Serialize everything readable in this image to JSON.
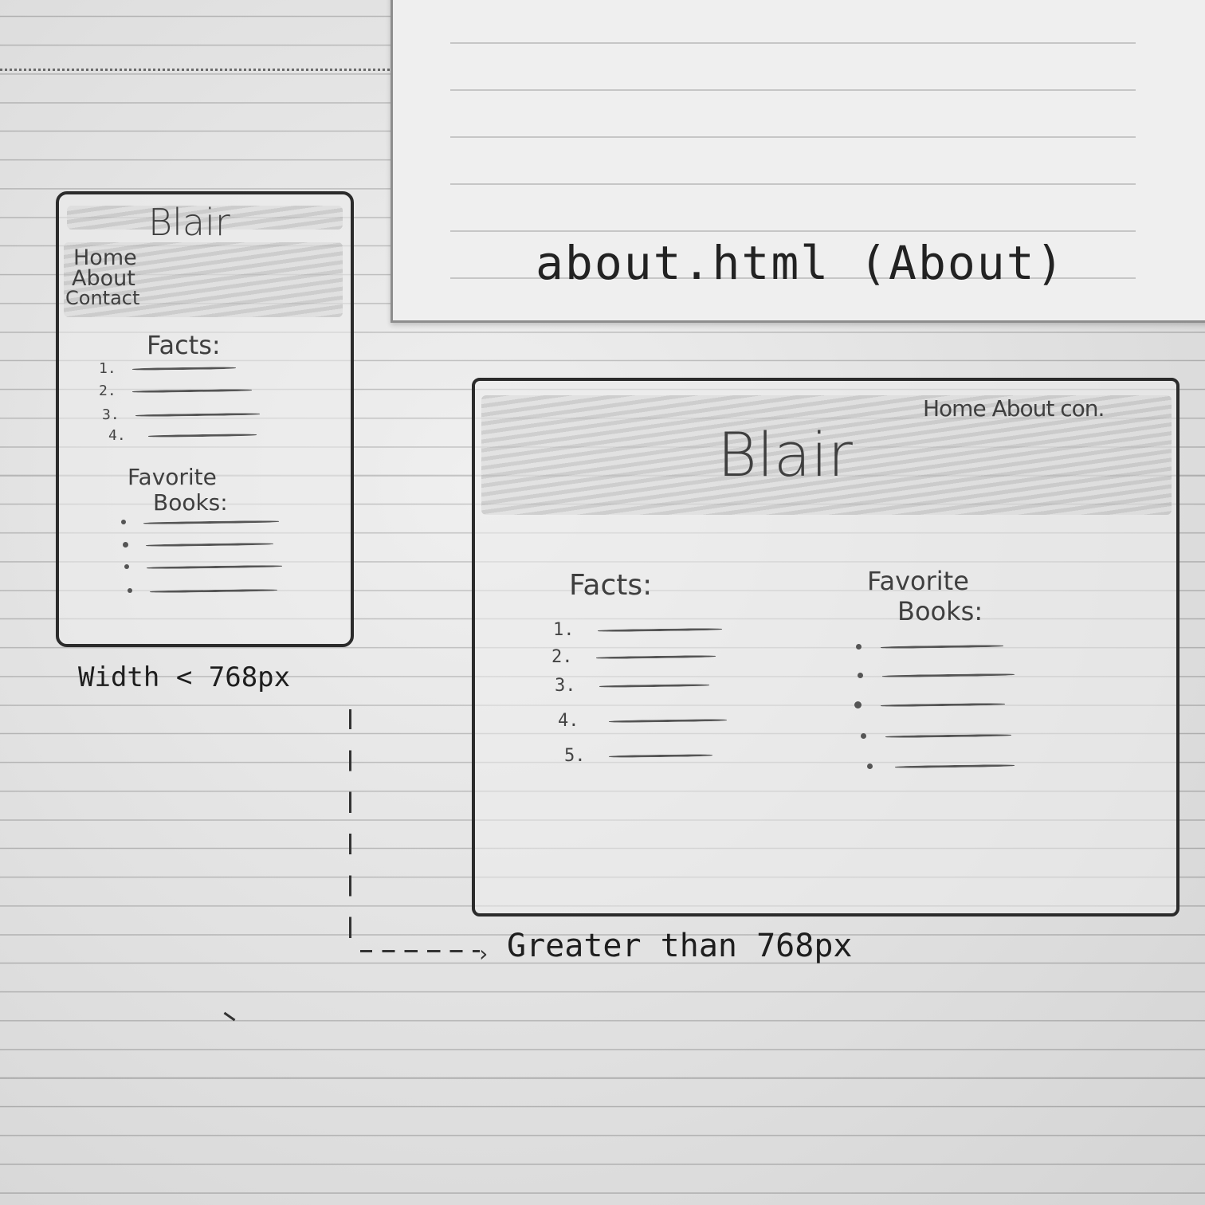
{
  "upper_page": {
    "caption": "about.html (About)"
  },
  "mobile_wireframe": {
    "site_title": "Blair",
    "nav": [
      "Home",
      "About",
      "Contact"
    ],
    "facts_heading": "Facts:",
    "facts_numbers": [
      "1.",
      "2.",
      "3.",
      "4."
    ],
    "books_heading_line1": "Favorite",
    "books_heading_line2": "Books:",
    "books_bullet_count": 4,
    "width_caption": "Width < 768px"
  },
  "desktop_wireframe": {
    "site_title": "Blair",
    "nav_text": "Home About con.",
    "facts_heading": "Facts:",
    "facts_numbers": [
      "1.",
      "2.",
      "3.",
      "4.",
      "5."
    ],
    "books_heading_line1": "Favorite",
    "books_heading_line2": "Books:",
    "books_bullet_count": 5,
    "width_caption": "Greater than 768px"
  },
  "colors": {
    "paper": "#ececec",
    "ink": "#2b2b2b",
    "pencil": "#555555"
  }
}
